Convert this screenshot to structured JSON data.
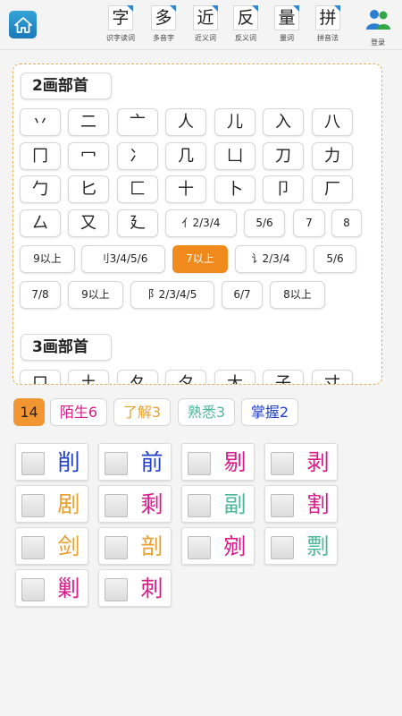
{
  "colors": {
    "stranger": "#d81b8a",
    "understand": "#e8a030",
    "familiar": "#4db89a",
    "master": "#2040c8",
    "active": "#f08a1c"
  },
  "toolbar": {
    "home_icon": "home-icon",
    "items": [
      {
        "glyph": "字",
        "label": "识字读词"
      },
      {
        "glyph": "多",
        "label": "多音字"
      },
      {
        "glyph": "近",
        "label": "近义词"
      },
      {
        "glyph": "反",
        "label": "反义词"
      },
      {
        "glyph": "量",
        "label": "量词"
      },
      {
        "glyph": "拼",
        "label": "拼音法"
      }
    ],
    "login_label": "登录"
  },
  "panel": {
    "section2_title": "2画部首",
    "section3_title": "3画部首",
    "row1": [
      "丷",
      "二",
      "亠",
      "人",
      "儿",
      "入",
      "八"
    ],
    "row2": [
      "冂",
      "冖",
      "冫",
      "几",
      "凵",
      "刀",
      "力"
    ],
    "row3": [
      "勹",
      "匕",
      "匚",
      "十",
      "卜",
      "卩",
      "厂"
    ],
    "row4": [
      "厶",
      "又",
      "廴",
      "亻2/3/4",
      "5/6",
      "7",
      "8"
    ],
    "row5": [
      "9以上",
      "刂3/4/5/6",
      "7以上",
      "讠2/3/4",
      "5/6"
    ],
    "row6": [
      "7/8",
      "9以上",
      "阝2/3/4/5",
      "6/7",
      "8以上"
    ],
    "row7": [
      "口",
      "土",
      "夂",
      "夕",
      "大",
      "子",
      "寸"
    ]
  },
  "filters": {
    "count": "14",
    "stranger": "陌生6",
    "understand": "了解3",
    "familiar": "熟悉3",
    "master": "掌握2"
  },
  "chars": [
    {
      "hz": "削",
      "color": "#2040c8"
    },
    {
      "hz": "前",
      "color": "#2040c8"
    },
    {
      "hz": "剔",
      "color": "#d81b8a"
    },
    {
      "hz": "剥",
      "color": "#d81b8a"
    },
    {
      "hz": "剧",
      "color": "#e8a030"
    },
    {
      "hz": "剩",
      "color": "#d81b8a"
    },
    {
      "hz": "副",
      "color": "#4db89a"
    },
    {
      "hz": "割",
      "color": "#d81b8a"
    },
    {
      "hz": "剑",
      "color": "#e8a030"
    },
    {
      "hz": "剖",
      "color": "#e8a030"
    },
    {
      "hz": "剜",
      "color": "#d81b8a"
    },
    {
      "hz": "剽",
      "color": "#4db89a"
    },
    {
      "hz": "剿",
      "color": "#d81b8a"
    },
    {
      "hz": "刺",
      "color": "#d81b8a"
    }
  ]
}
